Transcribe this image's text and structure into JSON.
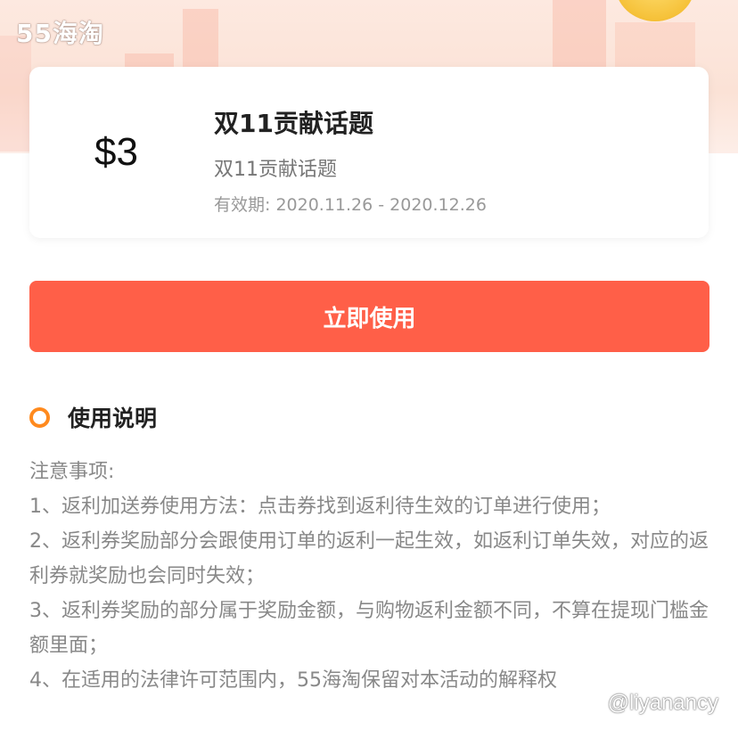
{
  "header": {
    "logo_text": "55海淘"
  },
  "coupon": {
    "amount": "$3",
    "title": "双11贡献话题",
    "subtitle": "双11贡献话题",
    "validity": "有效期: 2020.11.26 - 2020.12.26"
  },
  "actions": {
    "use_now_label": "立即使用"
  },
  "instructions": {
    "heading": "使用说明",
    "lines": [
      "注意事项:",
      "1、返利加送券使用方法：点击券找到返利待生效的订单进行使用；",
      "2、返利券奖励部分会跟使用订单的返利一起生效，如返利订单失效，对应的返利券就奖励也会同时失效；",
      "3、返利券奖励的部分属于奖励金额，与购物返利金额不同，不算在提现门槛金额里面；",
      "4、在适用的法律许可范围内，55海淘保留对本活动的解释权"
    ]
  },
  "watermark": "@liyanancy",
  "colors": {
    "accent": "#ff5f48",
    "bullet": "#ff8a1e",
    "hero_bg": "#fde9e0"
  }
}
